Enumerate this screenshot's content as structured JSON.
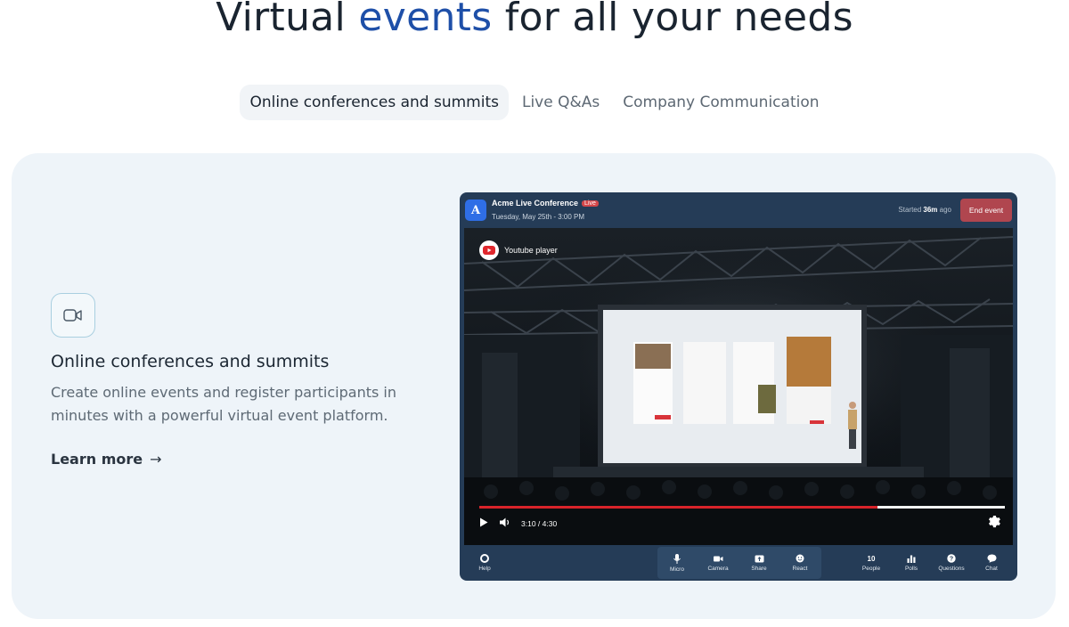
{
  "headline": {
    "part1": "Virtual ",
    "accent": "events",
    "part2": " for all your needs"
  },
  "tabs": [
    {
      "label": "Online conferences and summits",
      "active": true
    },
    {
      "label": "Live Q&As",
      "active": false
    },
    {
      "label": "Company Communication",
      "active": false
    }
  ],
  "feature": {
    "icon": "video-camera-icon",
    "title": "Online conferences and summits",
    "description": "Create online events and register participants in minutes with a powerful virtual event platform.",
    "link": "Learn more",
    "link_arrow": "→"
  },
  "app": {
    "logo_letter": "A",
    "title": "Acme Live Conference",
    "live_badge": "Live",
    "date": "Tuesday, May 25th - 3:00 PM",
    "started_prefix": "Started ",
    "started_value": "36m",
    "started_suffix": " ago",
    "end_button": "End event",
    "player_label": "Youtube player",
    "time": "3:10 / 4:30",
    "progress": 0.758,
    "controls": {
      "help": "Help",
      "micro": "Micro",
      "camera": "Camera",
      "share": "Share",
      "react": "React",
      "people_count": "10",
      "people": "People",
      "polls": "Polls",
      "questions": "Questions",
      "chat": "Chat"
    }
  },
  "colors": {
    "accent": "#1e4fa8",
    "panel_bg": "#eef4f9",
    "app_bg": "#253c57",
    "end_button": "#b0464f",
    "progress": "#d8232a"
  }
}
